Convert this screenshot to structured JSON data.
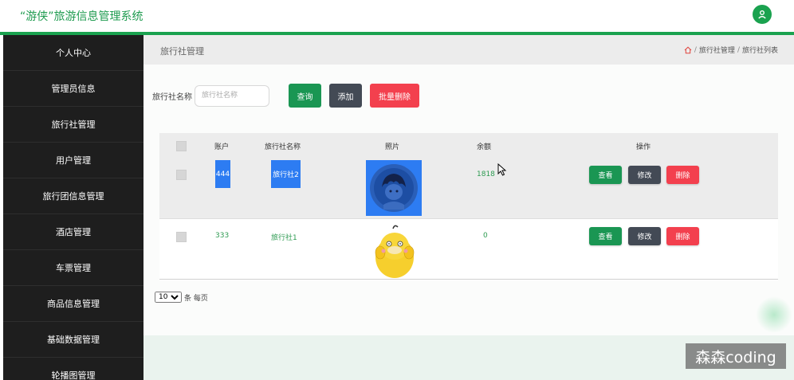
{
  "header": {
    "title": "“游侠”旅游信息管理系统",
    "user_icon": "user-icon"
  },
  "sidebar": {
    "items": [
      {
        "label": "个人中心"
      },
      {
        "label": "管理员信息"
      },
      {
        "label": "旅行社管理"
      },
      {
        "label": "用户管理"
      },
      {
        "label": "旅行团信息管理"
      },
      {
        "label": "酒店管理"
      },
      {
        "label": "车票管理"
      },
      {
        "label": "商品信息管理"
      },
      {
        "label": "基础数据管理"
      },
      {
        "label": "轮播图管理"
      }
    ]
  },
  "page": {
    "title": "旅行社管理",
    "breadcrumb": [
      "旅行社管理",
      "旅行社列表"
    ],
    "breadcrumb_sep": "/"
  },
  "search": {
    "label": "旅行社名称",
    "placeholder": "旅行社名称",
    "value": "",
    "query_button": "查询",
    "add_button": "添加",
    "batch_delete_button": "批量删除"
  },
  "table": {
    "headers": [
      "账户",
      "旅行社名称",
      "照片",
      "余额",
      "操作"
    ],
    "rows": [
      {
        "account": "444",
        "name": "旅行社2",
        "photo": "anime-avatar",
        "balance": "1818",
        "view": "查看",
        "edit": "修改",
        "delete": "删除"
      },
      {
        "account": "333",
        "name": "旅行社1",
        "photo": "yellow-duck",
        "balance": "0",
        "view": "查看",
        "edit": "修改",
        "delete": "删除"
      }
    ]
  },
  "pagination": {
    "page_size": "10",
    "per_page_label": "条 每页"
  },
  "watermark": "森森coding",
  "colors": {
    "brand_green": "#1aa24f",
    "sidebar_bg": "#1e1e1e",
    "danger": "#f3404e",
    "dark_button": "#434a55",
    "highlight_blue": "#2d7cf2"
  }
}
